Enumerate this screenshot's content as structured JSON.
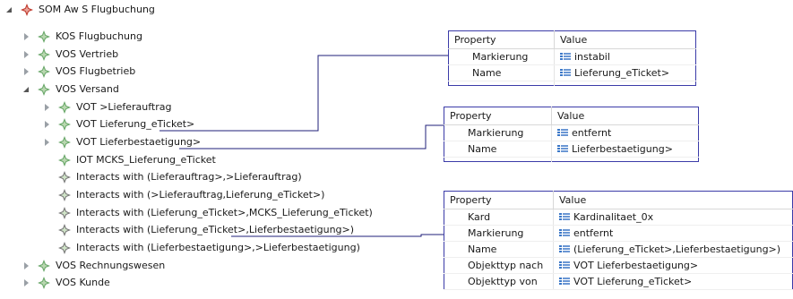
{
  "tree": {
    "root": {
      "label": "SOM Aw S Flugbuchung"
    },
    "items": [
      {
        "label": "KOS Flugbuchung"
      },
      {
        "label": "VOS Vertrieb"
      },
      {
        "label": "VOS Flugbetrieb"
      },
      {
        "label": "VOS Versand"
      },
      {
        "label": "VOT >Lieferauftrag"
      },
      {
        "label": "VOT Lieferung_eTicket>"
      },
      {
        "label": "VOT Lieferbestaetigung>"
      },
      {
        "label": "IOT MCKS_Lieferung_eTicket"
      },
      {
        "label": "Interacts with (Lieferauftrag>,>Lieferauftrag)"
      },
      {
        "label": "Interacts with (>Lieferauftrag,Lieferung_eTicket>)"
      },
      {
        "label": "Interacts with (Lieferung_eTicket>,MCKS_Lieferung_eTicket)"
      },
      {
        "label": "Interacts with (Lieferung_eTicket>,Lieferbestaetigung>)"
      },
      {
        "label": "Interacts with (Lieferbestaetigung>,>Lieferbestaetigung)"
      },
      {
        "label": "VOS Rechnungswesen"
      },
      {
        "label": "VOS Kunde"
      }
    ]
  },
  "tables": [
    {
      "header": {
        "property": "Property",
        "value": "Value"
      },
      "rows": [
        {
          "key": "Markierung",
          "value": "instabil"
        },
        {
          "key": "Name",
          "value": "Lieferung_eTicket>"
        }
      ]
    },
    {
      "header": {
        "property": "Property",
        "value": "Value"
      },
      "rows": [
        {
          "key": "Markierung",
          "value": "entfernt"
        },
        {
          "key": "Name",
          "value": "Lieferbestaetigung>"
        }
      ]
    },
    {
      "header": {
        "property": "Property",
        "value": "Value"
      },
      "rows": [
        {
          "key": "Kard",
          "value": "Kardinalitaet_0x"
        },
        {
          "key": "Markierung",
          "value": "entfernt"
        },
        {
          "key": "Name",
          "value": "(Lieferung_eTicket>,Lieferbestaetigung>)"
        },
        {
          "key": "Objekttyp nach",
          "value": "VOT Lieferbestaetigung>"
        },
        {
          "key": "Objekttyp von",
          "value": "VOT Lieferung_eTicket>"
        }
      ]
    }
  ],
  "colors": {
    "root_gem": "#c0392b",
    "gem": "#6aa86a",
    "gem_light": "#b9d7b0",
    "connector": "#1f1f7a",
    "table_border": "#3b3ba8"
  },
  "icons": {
    "tree_expanded": "triangle-expanded-icon",
    "tree_collapsed": "triangle-collapsed-icon",
    "element": "diamond-star-icon",
    "value": "list-value-icon"
  }
}
